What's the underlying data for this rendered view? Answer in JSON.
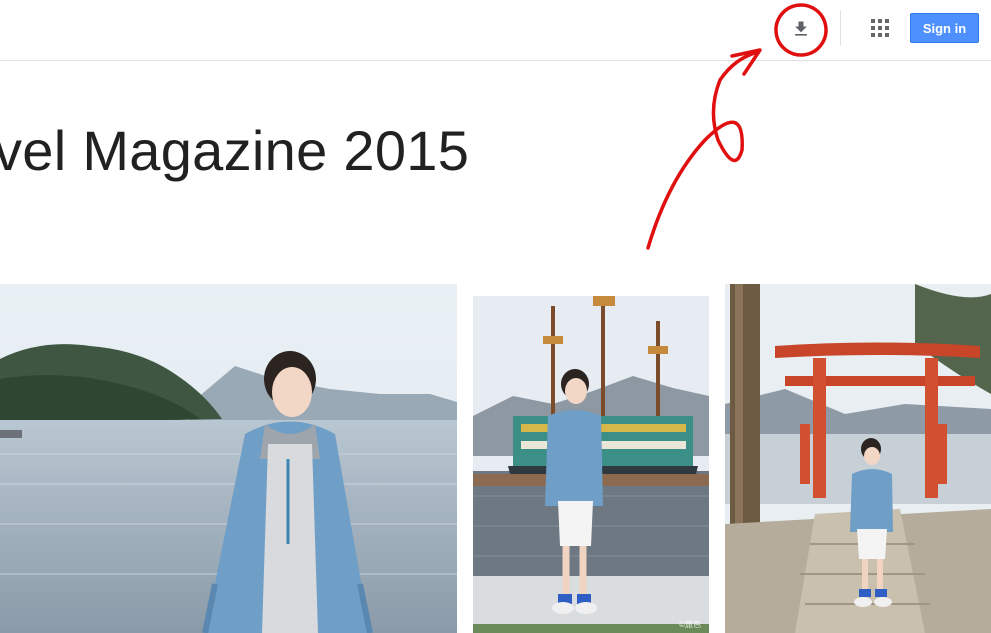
{
  "header": {
    "download_icon": "download-icon",
    "apps_icon": "apps-grid-icon",
    "signin_label": "Sign in"
  },
  "page": {
    "title": "vel Magazine 2015"
  },
  "photos": {
    "watermark": "©旅色"
  },
  "colors": {
    "accent_blue": "#4d90fe",
    "annotation_red": "#e01010",
    "title_text": "#212121"
  }
}
